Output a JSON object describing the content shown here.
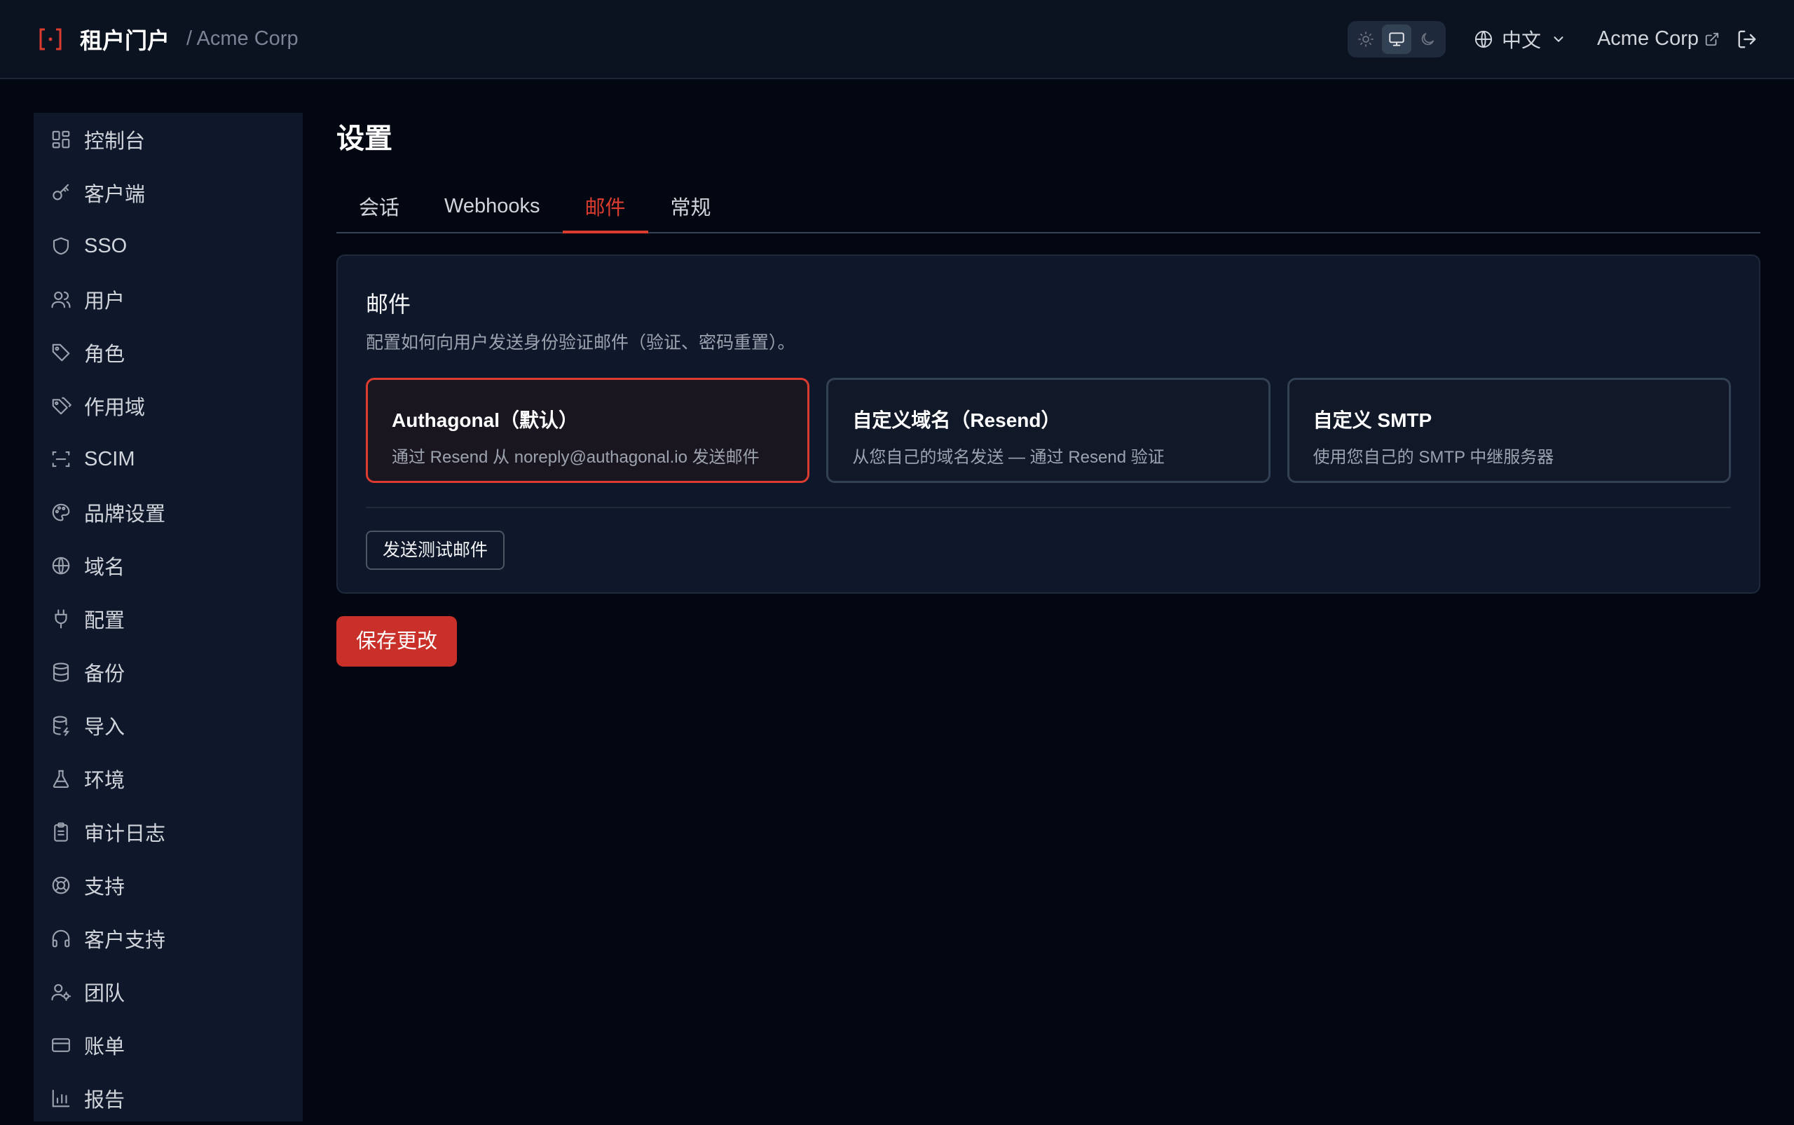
{
  "header": {
    "title": "租户门户",
    "org_breadcrumb": "/ Acme Corp",
    "language": "中文",
    "org_name": "Acme Corp",
    "theme_options": [
      "light",
      "system",
      "dark"
    ],
    "theme_selected": "system"
  },
  "sidebar": {
    "items": [
      {
        "label": "控制台",
        "icon": "dashboard-icon"
      },
      {
        "label": "客户端",
        "icon": "key-icon"
      },
      {
        "label": "SSO",
        "icon": "shield-icon"
      },
      {
        "label": "用户",
        "icon": "users-icon"
      },
      {
        "label": "角色",
        "icon": "tag-icon"
      },
      {
        "label": "作用域",
        "icon": "tags-icon"
      },
      {
        "label": "SCIM",
        "icon": "scan-icon"
      },
      {
        "label": "品牌设置",
        "icon": "palette-icon"
      },
      {
        "label": "域名",
        "icon": "globe-icon"
      },
      {
        "label": "配置",
        "icon": "plug-icon"
      },
      {
        "label": "备份",
        "icon": "database-icon"
      },
      {
        "label": "导入",
        "icon": "database-import-icon"
      },
      {
        "label": "环境",
        "icon": "flask-icon"
      },
      {
        "label": "审计日志",
        "icon": "clipboard-icon"
      },
      {
        "label": "支持",
        "icon": "lifebuoy-icon"
      },
      {
        "label": "客户支持",
        "icon": "headphones-icon"
      },
      {
        "label": "团队",
        "icon": "user-cog-icon"
      },
      {
        "label": "账单",
        "icon": "credit-card-icon"
      },
      {
        "label": "报告",
        "icon": "bar-chart-icon"
      }
    ]
  },
  "main": {
    "title": "设置",
    "tabs": [
      {
        "label": "会话",
        "active": false
      },
      {
        "label": "Webhooks",
        "active": false
      },
      {
        "label": "邮件",
        "active": true
      },
      {
        "label": "常规",
        "active": false
      }
    ],
    "card": {
      "title": "邮件",
      "description": "配置如何向用户发送身份验证邮件（验证、密码重置）。",
      "options": [
        {
          "title": "Authagonal（默认）",
          "description": "通过 Resend 从 noreply@authagonal.io 发送邮件",
          "selected": true
        },
        {
          "title": "自定义域名（Resend）",
          "description": "从您自己的域名发送 — 通过 Resend 验证",
          "selected": false
        },
        {
          "title": "自定义 SMTP",
          "description": "使用您自己的 SMTP 中继服务器",
          "selected": false
        }
      ],
      "test_button": "发送测试邮件"
    },
    "save_button": "保存更改"
  },
  "colors": {
    "accent": "#dc3c30",
    "background": "#030712",
    "panel": "#0f172a"
  }
}
